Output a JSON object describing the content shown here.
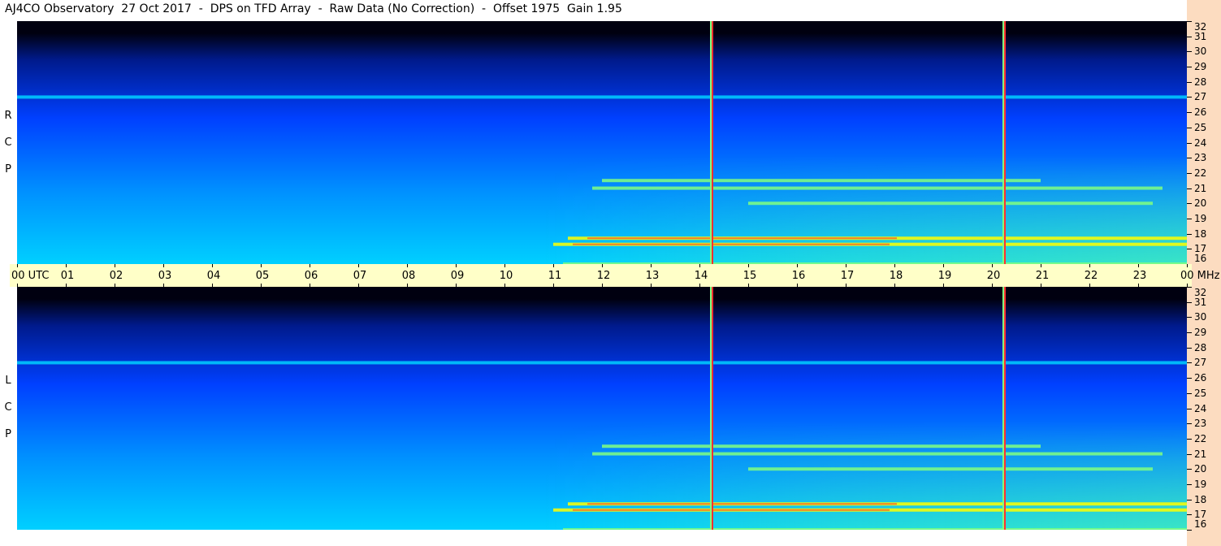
{
  "title": "AJ4CO Observatory  27 Oct 2017  -  DPS on TFD Array  -  Raw Data (No Correction)  -  Offset 1975  Gain 1.95",
  "chart_data": [
    {
      "type": "heatmap",
      "panel": "RCP",
      "side_label": [
        "R",
        "C",
        "P"
      ],
      "x_label_utc": "UTC",
      "y_unit": "MHz",
      "xlim_hours_utc": [
        0,
        24
      ],
      "ylim_mhz": [
        16,
        32
      ],
      "x_ticks": [
        "00",
        "01",
        "02",
        "03",
        "04",
        "05",
        "06",
        "07",
        "08",
        "09",
        "10",
        "11",
        "12",
        "13",
        "14",
        "15",
        "16",
        "17",
        "18",
        "19",
        "20",
        "21",
        "22",
        "23",
        "00"
      ],
      "y_ticks": [
        16,
        17,
        18,
        19,
        20,
        21,
        22,
        23,
        24,
        25,
        26,
        27,
        28,
        29,
        30,
        31,
        32
      ],
      "colormap": [
        "#000010",
        "#001a8c",
        "#0040ff",
        "#0090ff",
        "#00d0ff",
        "#80ff80",
        "#ffff00",
        "#ff3030"
      ],
      "vertical_interference_lines_utc": [
        14.25,
        20.25
      ],
      "horizontal_rfi_bands": [
        {
          "mhz": 17.3,
          "utc_start": 11.0,
          "utc_end": 24.0,
          "level": 0.85
        },
        {
          "mhz": 17.7,
          "utc_start": 11.3,
          "utc_end": 24.0,
          "level": 0.9
        },
        {
          "mhz": 16.0,
          "utc_start": 11.2,
          "utc_end": 24.0,
          "level": 0.8
        },
        {
          "mhz": 20.0,
          "utc_start": 15.0,
          "utc_end": 23.3,
          "level": 0.7
        },
        {
          "mhz": 21.0,
          "utc_start": 11.8,
          "utc_end": 23.5,
          "level": 0.65
        },
        {
          "mhz": 21.5,
          "utc_start": 12.0,
          "utc_end": 21.0,
          "level": 0.7
        },
        {
          "mhz": 27.0,
          "utc_start": 0.0,
          "utc_end": 24.0,
          "level": 0.45
        }
      ]
    },
    {
      "type": "heatmap",
      "panel": "LCP",
      "side_label": [
        "L",
        "C",
        "P"
      ],
      "y_unit": "MHz",
      "xlim_hours_utc": [
        0,
        24
      ],
      "ylim_mhz": [
        16,
        32
      ],
      "y_ticks": [
        16,
        17,
        18,
        19,
        20,
        21,
        22,
        23,
        24,
        25,
        26,
        27,
        28,
        29,
        30,
        31,
        32
      ],
      "colormap": [
        "#000010",
        "#001a8c",
        "#0040ff",
        "#0090ff",
        "#00d0ff",
        "#80ff80",
        "#ffff00",
        "#ff3030"
      ],
      "vertical_interference_lines_utc": [
        14.25,
        20.25
      ],
      "horizontal_rfi_bands": [
        {
          "mhz": 17.3,
          "utc_start": 11.0,
          "utc_end": 24.0,
          "level": 0.85
        },
        {
          "mhz": 17.7,
          "utc_start": 11.3,
          "utc_end": 24.0,
          "level": 0.9
        },
        {
          "mhz": 16.0,
          "utc_start": 11.2,
          "utc_end": 24.0,
          "level": 0.8
        },
        {
          "mhz": 20.0,
          "utc_start": 15.0,
          "utc_end": 23.3,
          "level": 0.7
        },
        {
          "mhz": 21.0,
          "utc_start": 11.8,
          "utc_end": 23.5,
          "level": 0.65
        },
        {
          "mhz": 21.5,
          "utc_start": 12.0,
          "utc_end": 21.0,
          "level": 0.7
        },
        {
          "mhz": 27.0,
          "utc_start": 0.0,
          "utc_end": 24.0,
          "level": 0.45
        }
      ]
    }
  ]
}
